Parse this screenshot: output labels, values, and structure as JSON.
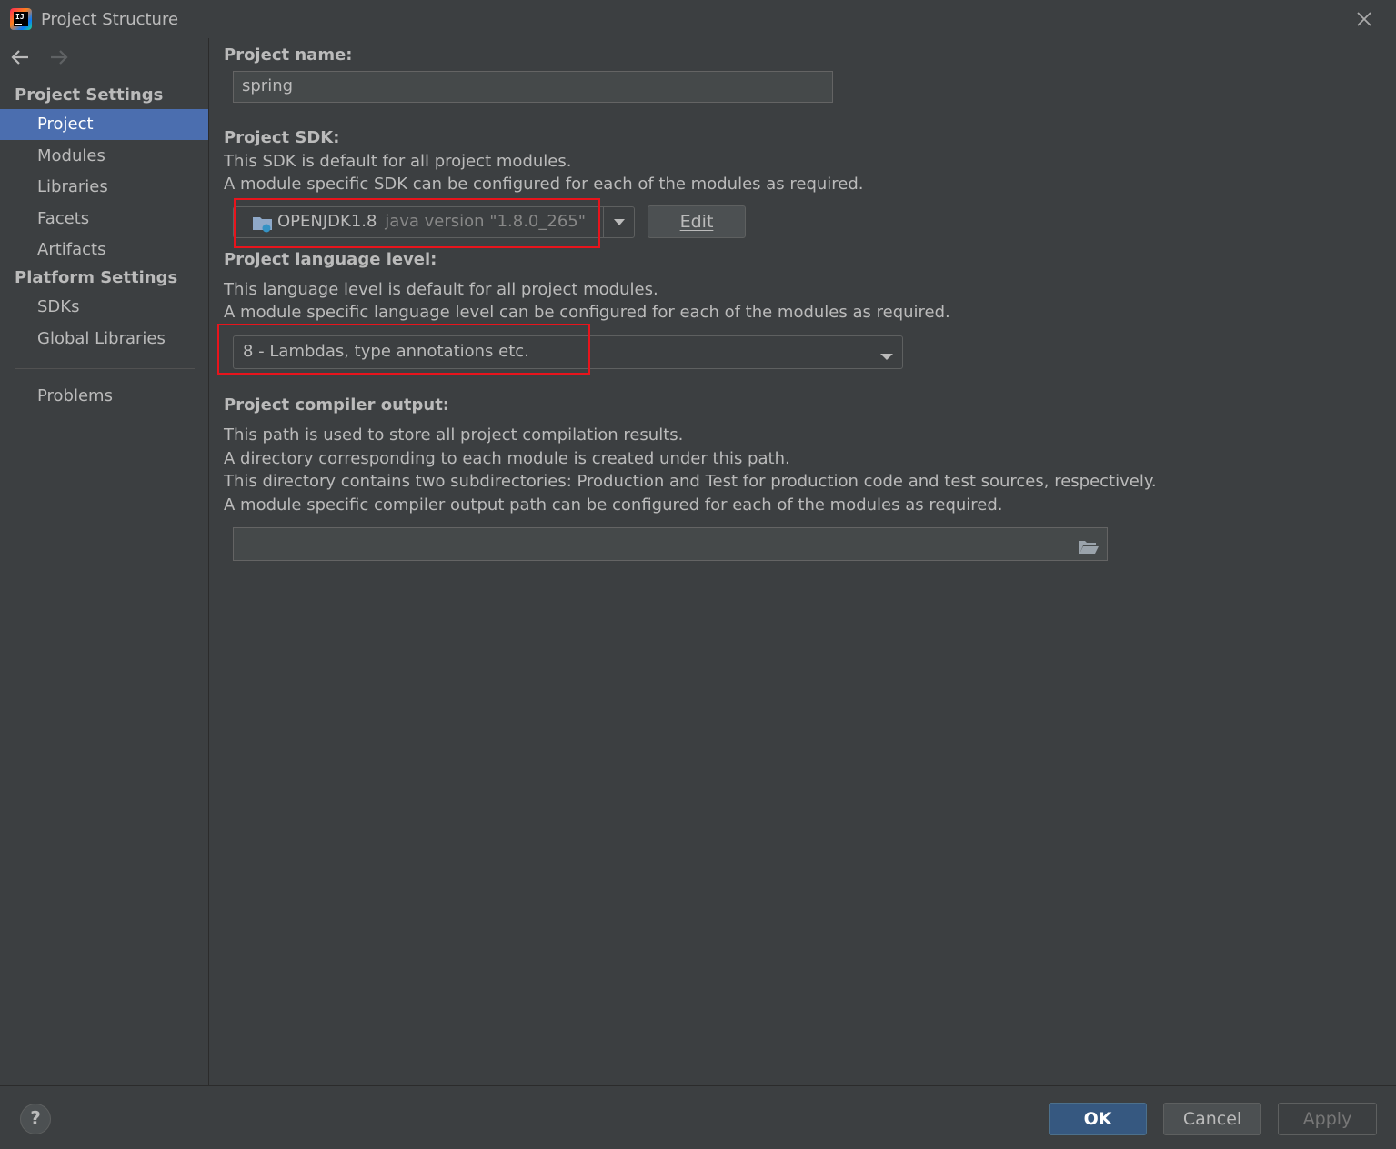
{
  "window": {
    "title": "Project Structure",
    "app_icon": "intellij-idea-icon"
  },
  "sidebar": {
    "project_settings_title": "Project Settings",
    "project_items": [
      "Project",
      "Modules",
      "Libraries",
      "Facets",
      "Artifacts"
    ],
    "platform_settings_title": "Platform Settings",
    "platform_items": [
      "SDKs",
      "Global Libraries"
    ],
    "problems": "Problems",
    "selected": "Project"
  },
  "main": {
    "project_name_label": "Project name:",
    "project_name_value": "spring",
    "sdk_label": "Project SDK:",
    "sdk_desc_1": "This SDK is default for all project modules.",
    "sdk_desc_2": "A module specific SDK can be configured for each of the modules as required.",
    "sdk_name": "OPENJDK1.8",
    "sdk_version": "java version \"1.8.0_265\"",
    "sdk_edit_label": "Edit",
    "language_level_label": "Project language level:",
    "language_desc_1": "This language level is default for all project modules.",
    "language_desc_2": "A module specific language level can be configured for each of the modules as required.",
    "language_level_value": "8 - Lambdas, type annotations etc.",
    "compiler_output_label": "Project compiler output:",
    "compiler_desc_1": "This path is used to store all project compilation results.",
    "compiler_desc_2": "A directory corresponding to each module is created under this path.",
    "compiler_desc_3": "This directory contains two subdirectories: Production and Test for production code and test sources, respectively.",
    "compiler_desc_4": "A module specific compiler output path can be configured for each of the modules as required.",
    "compiler_output_value": ""
  },
  "footer": {
    "help": "?",
    "ok": "OK",
    "cancel": "Cancel",
    "apply": "Apply"
  },
  "colors": {
    "background": "#3c3f41",
    "selection": "#4b6eaf",
    "ok_button": "#365880",
    "annotation_red": "#e8141c"
  }
}
